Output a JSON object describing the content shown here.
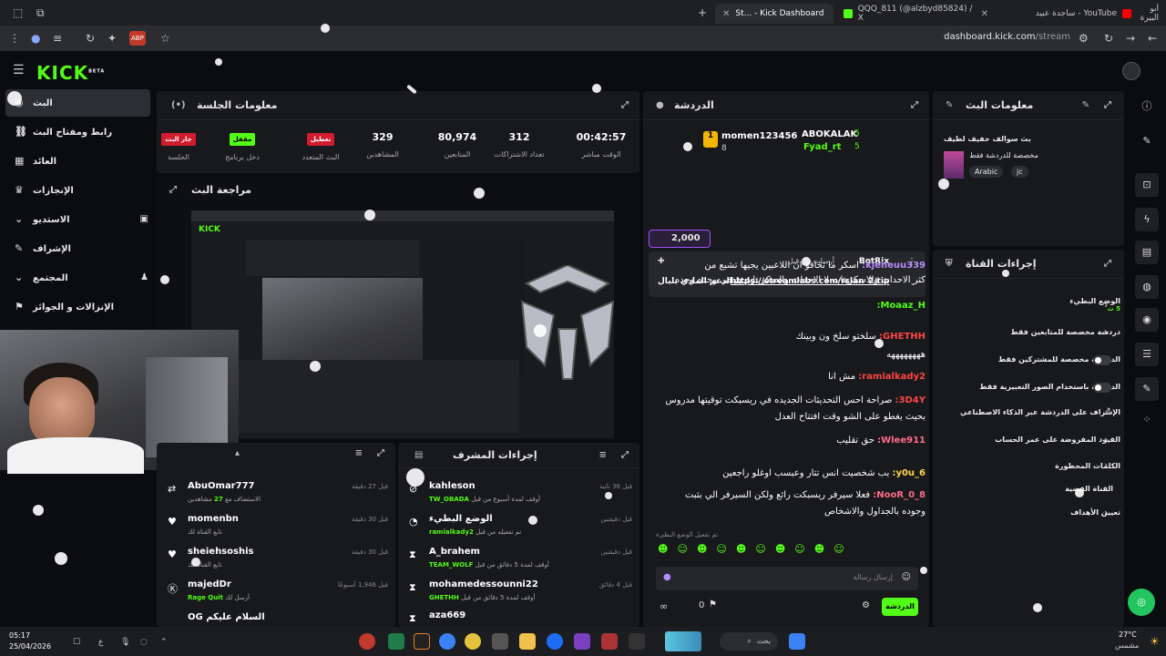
{
  "browser": {
    "tabs": [
      {
        "label": "St... - Kick Dashboard",
        "active": true
      },
      {
        "label": "QQQ_811 (@alzbyd85824) / X",
        "active": false
      },
      {
        "label": "YouTube - ساجدة عبيد",
        "active": false
      },
      {
        "label": "أبو البيرة",
        "active": false
      }
    ],
    "url_host": "dashboard.kick.com",
    "url_path": "/stream"
  },
  "app": {
    "logo": "KICK",
    "logo_sup": "BETA"
  },
  "sidebar": {
    "items": [
      {
        "label": "البث",
        "active": true
      },
      {
        "label": "رابط ومفتاح البث"
      },
      {
        "label": "العائد"
      },
      {
        "label": "الإنجازات"
      },
      {
        "label": "الاستديو"
      },
      {
        "label": "الإشراف"
      },
      {
        "label": "المجتمع"
      },
      {
        "label": "الإنزالات و الجوائز"
      }
    ]
  },
  "session": {
    "title": "معلومات الجلسة",
    "stats": [
      {
        "value": "00:42:57",
        "label": "الوقت مباشر"
      },
      {
        "value": "312",
        "label": "تعداد الاشتراكات"
      },
      {
        "value": "80,974",
        "label": "المتابعين"
      },
      {
        "value": "329",
        "label": "المشاهدين"
      }
    ],
    "badges": [
      {
        "badge": "تعطيل",
        "label": "البث المتعدد"
      },
      {
        "badge": "مقفل",
        "label": "دخل برنامج"
      },
      {
        "badge": "جار البث",
        "label": "الجلسة"
      }
    ]
  },
  "preview": {
    "title": "مراجعة البث"
  },
  "activity": {
    "items": [
      {
        "name": "AbuOmar777",
        "sub_prefix": "الاستضاف مع",
        "sub_value": "27",
        "sub_suffix": "مشاهدين",
        "time": "قبل 27 دقيقة"
      },
      {
        "name": "momenbn",
        "sub": "تابع القناة لك",
        "time": "قبل 30 دقيقة"
      },
      {
        "name": "sheiehsoshis",
        "sub": "تابع القناة لك",
        "time": "قبل 30 دقيقة"
      },
      {
        "name": "majedDr",
        "sub_prefix": "أرسل لك",
        "sub_value": "Rage Quit",
        "time": "قبل 1,946 أسبوعًا"
      },
      {
        "name": "OG السلام عليكم",
        "sub": "",
        "time": ""
      }
    ]
  },
  "modactions": {
    "title": "إجراءات المشرف",
    "items": [
      {
        "name": "kahleson",
        "sub_prefix": "أوقف لمدة أسبوع من قبل",
        "sub_value": "TW_OBADA",
        "time": "قبل 36 ثانية"
      },
      {
        "name": "الوضع البطيء",
        "sub_prefix": "تم تفعيله من قبل",
        "sub_value": "ramialkady2",
        "time": "قبل دقيقتين"
      },
      {
        "name": "A_brahem",
        "sub_prefix": "أوقف لمدة 5 دقائق من قبل",
        "sub_value": "TEAM_WOLF",
        "time": "قبل دقيقتين"
      },
      {
        "name": "mohamedessounni22",
        "sub_prefix": "أوقف لمدة 5 دقائق من قبل",
        "sub_value": "GHETHH",
        "time": "قبل 4 دقائق"
      },
      {
        "name": "aza669",
        "sub": "",
        "time": ""
      }
    ]
  },
  "chat": {
    "title": "الدردشة",
    "top_gifters": [
      {
        "name": "momen123456",
        "count": "8"
      },
      {
        "name": "ABOKALAK",
        "count": "5"
      },
      {
        "name": "Fyad_rt",
        "count": "5"
      }
    ],
    "kicks": "2,000",
    "pinned_by": "أرسلت من قبل",
    "pinned_user": "BotRix",
    "pinned_text": "رابط الدعم المادي بلبال",
    "pinned_link": "https://streamlabs.com/rslan_2/tip",
    "messages": [
      {
        "user": "kjeheuu339:",
        "color": "#b78cff",
        "text": "اسكر ما تخافو ان اللاعبين يجيها تشبع من"
      },
      {
        "user": "",
        "color": "#fff",
        "text": "كثر الاحداث والاسكربتات لا الاحداث والسكربتات بتيجي وحده وحده"
      },
      {
        "user": "Moaaz_H:",
        "color": "#53fc18",
        "text": ""
      },
      {
        "user": "GHETHH:",
        "color": "#ff4444",
        "text": "سلختو سلخ ون وبينك"
      },
      {
        "user": "",
        "color": "#fff",
        "text": "ههههههههه"
      },
      {
        "user": "ramialkady2:",
        "color": "#ff4444",
        "text": "مش انا"
      },
      {
        "user": "3D4Y:",
        "color": "#ff4444",
        "text": "صراحة احس التحديثات الجديده في ريسبكت توقيتها مدروس"
      },
      {
        "user": "",
        "color": "#fff",
        "text": "بحيث يغطو على الشو وقت افتتاح العدل"
      },
      {
        "user": "Wlee911:",
        "color": "#ff6b8a",
        "text": "حق تقليب"
      },
      {
        "user": "y0u_6:",
        "color": "#ffd84a",
        "text": "بب شخصيت انس تتار وعبسب اوغلو راجعين"
      },
      {
        "user": "NooR_0_8:",
        "color": "#ff6b8a",
        "text": "فعلا سيرفر ريسبكت رائع ولكن السيرفر الي بثبت"
      },
      {
        "user": "",
        "color": "#fff",
        "text": "وجوده بالجداول والاشخاص"
      }
    ],
    "slow_mode_note": "تم تفعيل الوضع البطيء",
    "input_placeholder": "إرسال رسالة",
    "send_label": "الدردشة",
    "viewer_count": "0"
  },
  "streaminfo": {
    "title": "معلومات البث",
    "stream_title": "بث سوالف خفيف لطيف",
    "category": "مخصصة للدردشة فقط",
    "tags": [
      "Arabic",
      "jc"
    ]
  },
  "channel": {
    "title": "إجراءات القناة",
    "rows": [
      {
        "label": "الوضع البطيء",
        "value": "5 ث",
        "control": "chevron"
      },
      {
        "label": "دردشة مخصصة للمتابعين فقط",
        "control": "chevron"
      },
      {
        "label": "الدردشة مخصصة للمشتركين فقط",
        "control": "toggle"
      },
      {
        "label": "الدردشة باستخدام الصور التعبيرية فقط",
        "control": "toggle"
      },
      {
        "label": "الإشراف على الدردشة عبر الذكاء الاصطناعي",
        "control": "link"
      },
      {
        "label": "القيود المفروضة على عمر الحساب",
        "control": "chevron"
      },
      {
        "label": "الكلمات المحظورة",
        "control": "chevron"
      },
      {
        "label": "القناة الفضية",
        "control": ""
      },
      {
        "label": "تعيين الأهداف",
        "control": "chevron"
      }
    ]
  },
  "taskbar": {
    "time": "05:17",
    "date": "25/04/2026",
    "lang": "ع",
    "search": "بحث",
    "weather_temp": "27°C",
    "weather_desc": "مشمس"
  }
}
